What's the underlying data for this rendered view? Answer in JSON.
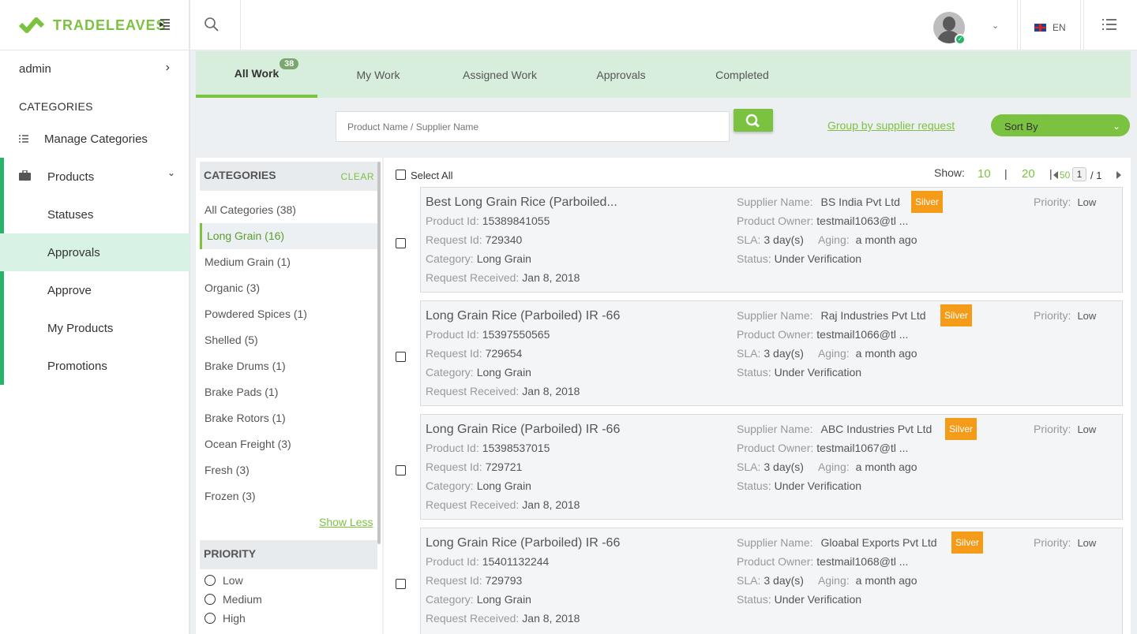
{
  "brand": {
    "name": "TRADELEAVES"
  },
  "sidebar": {
    "user": "admin",
    "section_heading": "CATEGORIES",
    "items": [
      {
        "label": "Manage Categories"
      },
      {
        "label": "Products"
      },
      {
        "label": "Statuses"
      },
      {
        "label": "Approvals"
      },
      {
        "label": "Approve"
      },
      {
        "label": "My Products"
      },
      {
        "label": "Promotions"
      }
    ]
  },
  "topbar": {
    "language": "EN"
  },
  "tabs": [
    {
      "label": "All Work",
      "badge": "38"
    },
    {
      "label": "My Work"
    },
    {
      "label": "Assigned Work"
    },
    {
      "label": "Approvals"
    },
    {
      "label": "Completed"
    }
  ],
  "search": {
    "placeholder": "Product Name / Supplier Name",
    "group_link": "Group by supplier request",
    "sort_label": "Sort By"
  },
  "filters": {
    "categories_title": "CATEGORIES",
    "clear_label": "CLEAR",
    "categories": [
      "All Categories (38)",
      "Long Grain (16)",
      "Medium Grain (1)",
      "Organic (3)",
      "Powdered Spices (1)",
      "Shelled (5)",
      "Brake Drums (1)",
      "Brake Pads (1)",
      "Brake Rotors (1)",
      "Ocean Freight (3)",
      "Fresh (3)",
      "Frozen (3)"
    ],
    "selected_category": "Long Grain (16)",
    "show_less": "Show Less",
    "priority_title": "PRIORITY",
    "priorities": [
      "Low",
      "Medium",
      "High"
    ]
  },
  "results": {
    "select_all": "Select All",
    "show_label": "Show:",
    "page_size_options": [
      "10",
      "20",
      "50"
    ],
    "current_page": "1",
    "total_pages": "/ 1",
    "labels": {
      "product_id": "Product Id:",
      "request_id": "Request Id:",
      "category": "Category:",
      "request_received": "Request Received:",
      "supplier_name": "Supplier Name:",
      "product_owner": "Product Owner:",
      "sla": "SLA:",
      "aging": "Aging:",
      "status": "Status:",
      "priority": "Priority:"
    },
    "items": [
      {
        "title": "Best Long Grain Rice (Parboiled...",
        "product_id": "15389841055",
        "request_id": "729340",
        "category": "Long Grain",
        "received": "Jan 8, 2018",
        "supplier": "BS India Pvt Ltd",
        "tier": "Silver",
        "owner": "testmail1063@tl ...",
        "sla": "3 day(s)",
        "aging": "a month ago",
        "status": "Under Verification",
        "priority": "Low"
      },
      {
        "title": "Long Grain Rice (Parboiled) IR -66",
        "product_id": "15397550565",
        "request_id": "729654",
        "category": "Long Grain",
        "received": "Jan 8, 2018",
        "supplier": "Raj Industries Pvt Ltd",
        "tier": "Silver",
        "owner": "testmail1066@tl ...",
        "sla": "3 day(s)",
        "aging": "a month ago",
        "status": "Under Verification",
        "priority": "Low"
      },
      {
        "title": "Long Grain Rice (Parboiled) IR -66",
        "product_id": "15398537015",
        "request_id": "729721",
        "category": "Long Grain",
        "received": "Jan 8, 2018",
        "supplier": "ABC Industries Pvt Ltd",
        "tier": "Silver",
        "owner": "testmail1067@tl ...",
        "sla": "3 day(s)",
        "aging": "a month ago",
        "status": "Under Verification",
        "priority": "Low"
      },
      {
        "title": "Long Grain Rice (Parboiled) IR -66",
        "product_id": "15401132244",
        "request_id": "729793",
        "category": "Long Grain",
        "received": "Jan 8, 2018",
        "supplier": "Gloabal Exports Pvt Ltd",
        "tier": "Silver",
        "owner": "testmail1068@tl ...",
        "sla": "3 day(s)",
        "aging": "a month ago",
        "status": "Under Verification",
        "priority": "Low"
      }
    ]
  },
  "colors": {
    "accent": "#7cc241",
    "sidebar_active": "#d8f2e6",
    "tier_badge": "#f59b1a",
    "tab_bar": "#d8eedc"
  }
}
